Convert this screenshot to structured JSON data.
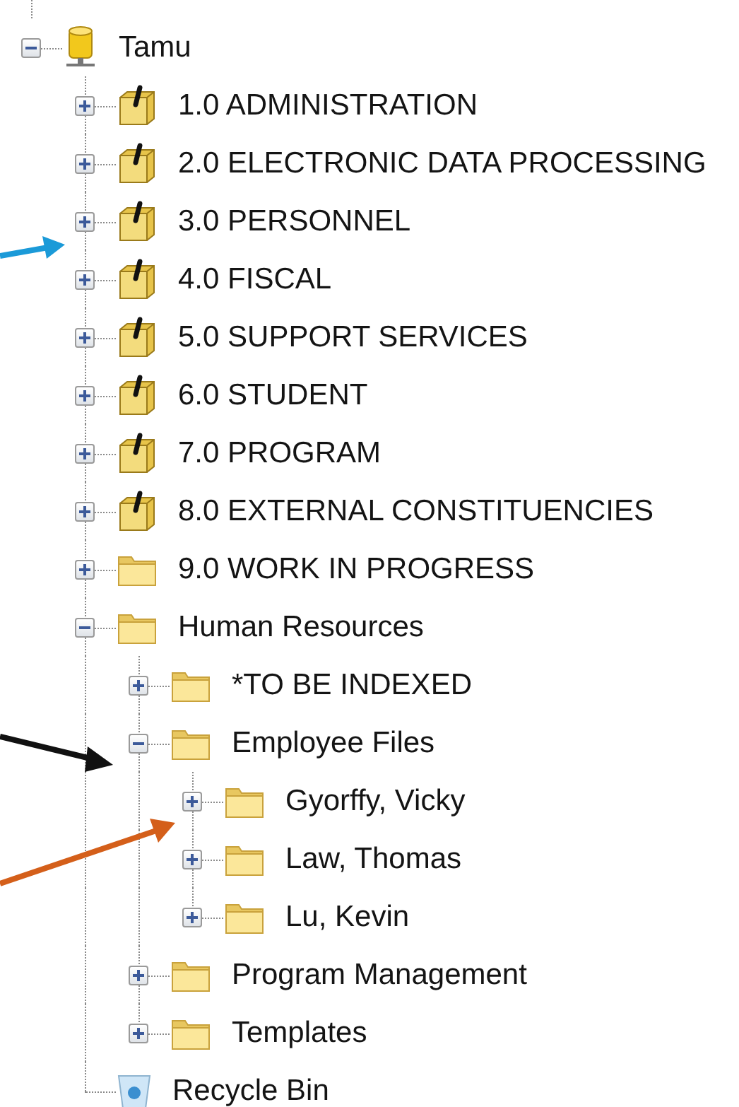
{
  "tree": [
    {
      "label": "Tamu",
      "kind": "drive",
      "expanded": true,
      "children": [
        {
          "label": "1.0 ADMINISTRATION",
          "kind": "archive",
          "expanded": false
        },
        {
          "label": "2.0 ELECTRONIC DATA PROCESSING",
          "kind": "archive",
          "expanded": false
        },
        {
          "label": "3.0 PERSONNEL",
          "kind": "archive",
          "expanded": false
        },
        {
          "label": "4.0 FISCAL",
          "kind": "archive",
          "expanded": false
        },
        {
          "label": "5.0 SUPPORT SERVICES",
          "kind": "archive",
          "expanded": false
        },
        {
          "label": "6.0 STUDENT",
          "kind": "archive",
          "expanded": false
        },
        {
          "label": "7.0 PROGRAM",
          "kind": "archive",
          "expanded": false
        },
        {
          "label": "8.0 EXTERNAL CONSTITUENCIES",
          "kind": "archive",
          "expanded": false
        },
        {
          "label": "9.0 WORK IN PROGRESS",
          "kind": "folder",
          "expanded": false
        },
        {
          "label": "Human Resources",
          "kind": "folder",
          "expanded": true,
          "children": [
            {
              "label": "*TO BE INDEXED",
              "kind": "folder",
              "expanded": false
            },
            {
              "label": "Employee Files",
              "kind": "folder",
              "expanded": true,
              "children": [
                {
                  "label": "Gyorffy, Vicky",
                  "kind": "folder",
                  "expanded": false
                },
                {
                  "label": "Law, Thomas",
                  "kind": "folder",
                  "expanded": false
                },
                {
                  "label": "Lu, Kevin",
                  "kind": "folder",
                  "expanded": false
                }
              ]
            },
            {
              "label": "Program Management",
              "kind": "folder",
              "expanded": false
            },
            {
              "label": "Templates",
              "kind": "folder",
              "expanded": false
            }
          ]
        },
        {
          "label": "Recycle Bin",
          "kind": "recycle-bin"
        }
      ]
    }
  ]
}
